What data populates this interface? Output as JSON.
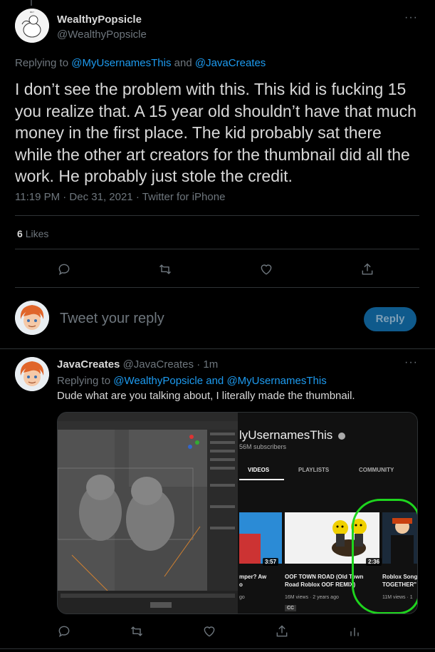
{
  "main_tweet": {
    "author_name": "WealthyPopsicle",
    "author_handle": "@WealthyPopsicle",
    "replying_prefix": "Replying to",
    "replying_user1": "@MyUsernamesThis",
    "replying_and": "and",
    "replying_user2": "@JavaCreates",
    "body": "I don’t see the problem with this. This kid is fucking 15 you realize that. A 15 year old shouldn’t have that much money in the first place. The kid probably sat there while the other art creators for the thumbnail did all the work. He probably just stole the credit.",
    "meta": "11:19 PM · Dec 31, 2021 · Twitter for iPhone",
    "like_count": "6",
    "likes_label": "Likes",
    "more": "···"
  },
  "reply_box": {
    "placeholder": "Tweet your reply",
    "button": "Reply"
  },
  "reply_tweet": {
    "author_name": "JavaCreates",
    "author_handle": "@JavaCreates",
    "time": "· 1m",
    "replying_prefix": "Replying to",
    "replying_user1": "@WealthyPopsicle",
    "replying_and": "and",
    "replying_user2": "@MyUsernamesThis",
    "body": "Dude what are you talking about, I literally made the thumbnail.",
    "more": "···"
  },
  "media": {
    "channel_title": "lyUsernamesThis",
    "subscribers": "56M subscribers",
    "tabs": [
      "VIDEOS",
      "PLAYLISTS",
      "COMMUNITY"
    ],
    "videos": [
      {
        "duration": "3:57",
        "title": "mper? Aw\no",
        "meta": "go"
      },
      {
        "duration": "",
        "title": "OOF TOWN ROAD (Old Town\nRoad Roblox OOF REMIX)",
        "meta": "16M views · 2 years ago",
        "badge": "CC"
      },
      {
        "duration": "2:36",
        "title": "Roblox Song\nTOGETHER\"",
        "meta": "11M views · 1"
      }
    ]
  },
  "icons": {
    "reply": "reply-icon",
    "retweet": "retweet-icon",
    "like": "heart-icon",
    "share": "share-icon",
    "analytics": "analytics-icon",
    "verified": "verified-icon"
  },
  "colors": {
    "background": "#000000",
    "text": "#d9d9d9",
    "muted": "#6e767d",
    "link": "#1d9bf0",
    "reply_button": "#0f5a8c",
    "annotation": "#1ed51e"
  }
}
